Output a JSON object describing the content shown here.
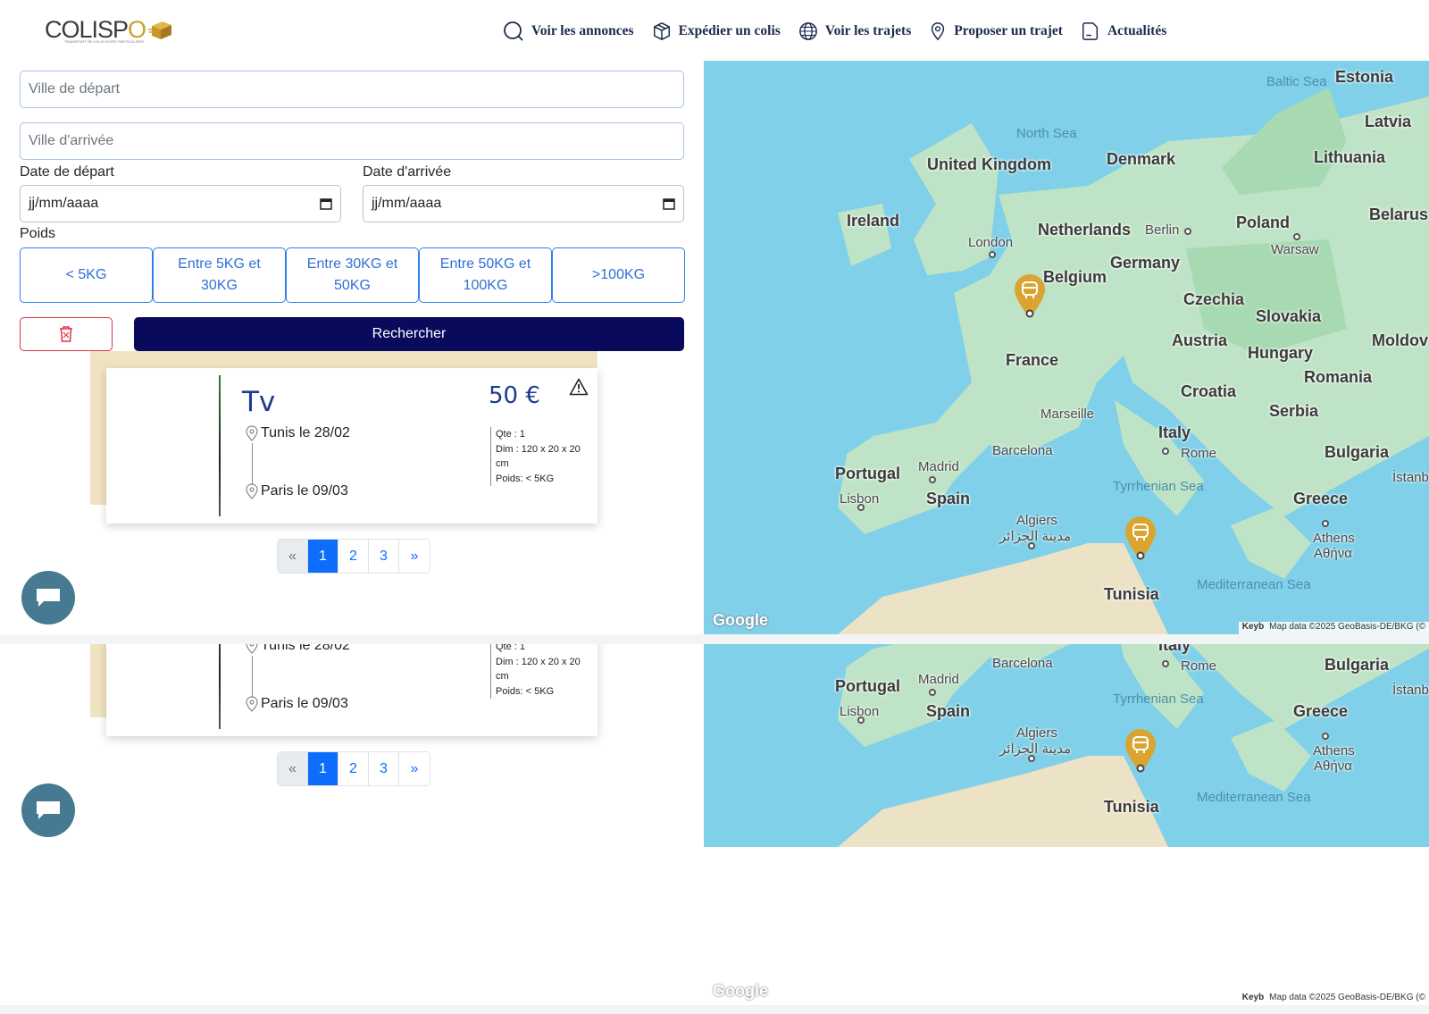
{
  "brand": {
    "name_pre": "COLISP",
    "name_o": "O",
    "tagline": "TRANSPORT DE COLIS ENTRE PARTICULIERS"
  },
  "nav": [
    {
      "label": "Voir les annonces",
      "icon": "search-icon"
    },
    {
      "label": "Expédier un colis",
      "icon": "package-icon"
    },
    {
      "label": "Voir les trajets",
      "icon": "globe-icon"
    },
    {
      "label": "Proposer un trajet",
      "icon": "map-pin-icon"
    },
    {
      "label": "Actualités",
      "icon": "news-icon"
    }
  ],
  "search": {
    "departure_placeholder": "Ville de départ",
    "arrival_placeholder": "Ville d'arrivée",
    "departure_date_label": "Date de départ",
    "arrival_date_label": "Date d'arrivée",
    "date_placeholder": "jj/mm/aaaa",
    "weight_label": "Poids",
    "weights": [
      "< 5KG",
      "Entre 5KG et 30KG",
      "Entre 30KG et 50KG",
      "Entre 50KG et 100KG",
      ">100KG"
    ],
    "submit_label": "Rechercher"
  },
  "listing": {
    "title": "Tv",
    "price": "50 €",
    "from": "Tunis le 28/02",
    "to": "Paris le 09/03",
    "qty": "Qte : 1",
    "dim": "Dim : 120 x 20 x 20 cm",
    "weight": "Poids: < 5KG"
  },
  "pagination": {
    "prev": "«",
    "pages": [
      "1",
      "2",
      "3"
    ],
    "active": "1",
    "next": "»"
  },
  "map": {
    "countries": [
      "Estonia",
      "Latvia",
      "Lithuania",
      "Belarus",
      "Denmark",
      "United Kingdom",
      "Ireland",
      "Netherlands",
      "Poland",
      "Germany",
      "Belgium",
      "Czechia",
      "Slovakia",
      "Austria",
      "Hungary",
      "Moldov",
      "France",
      "Romania",
      "Croatia",
      "Serbia",
      "Italy",
      "Bulgaria",
      "Portugal",
      "Spain",
      "Greece",
      "Tunisia"
    ],
    "cities": [
      "London",
      "Berlin",
      "Warsaw",
      "Marseille",
      "Barcelona",
      "Madrid",
      "Lisbon",
      "Rome",
      "Algiers",
      "مدينة الجزائر",
      "Athens",
      "Αθήνα",
      "İstanbu"
    ],
    "seas": [
      "Baltic Sea",
      "North Sea",
      "Tyrrhenian Sea",
      "Mediterranean Sea"
    ],
    "google": "Google",
    "attribution_kb": "Keyb",
    "attribution": "Map data ©2025 GeoBasis-DE/BKG (©"
  }
}
